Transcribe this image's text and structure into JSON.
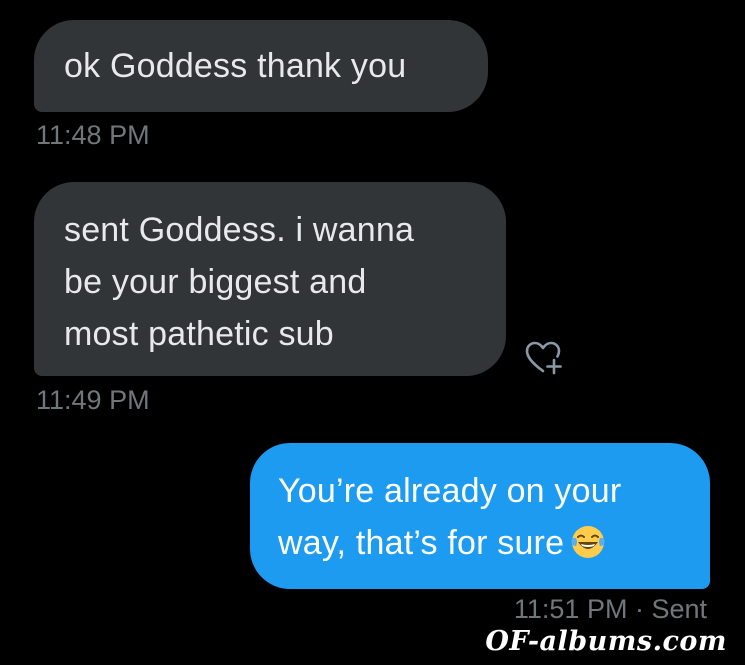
{
  "conversation": {
    "messages": [
      {
        "direction": "received",
        "lines": [
          "ok Goddess thank you"
        ],
        "timestamp": "11:48 PM"
      },
      {
        "direction": "received",
        "lines": [
          "sent Goddess. i wanna",
          "be your biggest and",
          "most pathetic sub"
        ],
        "timestamp": "11:49 PM",
        "reaction_icon": "heart-plus-icon"
      },
      {
        "direction": "sent",
        "lines": [
          "You’re already on your",
          "way, that’s for sure"
        ],
        "emoji": "laughing-crying-emoji-icon",
        "timestamp": "11:51 PM · Sent"
      }
    ]
  },
  "watermark": {
    "text": "OF-albums.com"
  },
  "colors": {
    "background": "#000000",
    "received_bubble": "#323538",
    "sent_bubble": "#1d9bf0",
    "timestamp": "#71767b"
  }
}
